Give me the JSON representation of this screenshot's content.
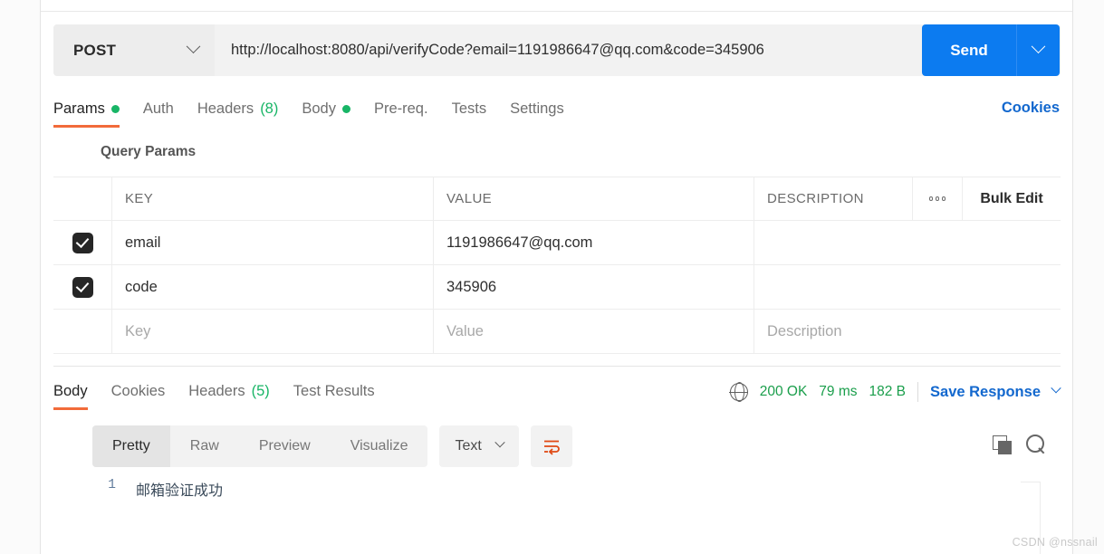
{
  "request": {
    "method": "POST",
    "method_dropdown_icon": "chevron-down-icon",
    "url": "http://localhost:8080/api/verifyCode?email=1191986647@qq.com&code=345906",
    "send_label": "Send",
    "send_dropdown_icon": "chevron-down-icon",
    "cookies_label": "Cookies",
    "tabs": [
      {
        "label": "Params",
        "badge": "",
        "dot": true,
        "active": true
      },
      {
        "label": "Auth",
        "badge": "",
        "dot": false,
        "active": false
      },
      {
        "label": "Headers",
        "badge": "(8)",
        "dot": false,
        "active": false
      },
      {
        "label": "Body",
        "badge": "",
        "dot": true,
        "active": false
      },
      {
        "label": "Pre-req.",
        "badge": "",
        "dot": false,
        "active": false
      },
      {
        "label": "Tests",
        "badge": "",
        "dot": false,
        "active": false
      },
      {
        "label": "Settings",
        "badge": "",
        "dot": false,
        "active": false
      }
    ]
  },
  "query_params": {
    "section_title": "Query Params",
    "columns": [
      "KEY",
      "VALUE",
      "DESCRIPTION"
    ],
    "options_icon": "three-dots-icon",
    "bulk_edit_label": "Bulk Edit",
    "rows": [
      {
        "checked": true,
        "key": "email",
        "value": "1191986647@qq.com",
        "description": ""
      },
      {
        "checked": true,
        "key": "code",
        "value": "345906",
        "description": ""
      }
    ],
    "placeholder_row": {
      "key": "Key",
      "value": "Value",
      "description": "Description"
    }
  },
  "response": {
    "tabs": [
      {
        "label": "Body",
        "badge": "",
        "active": true
      },
      {
        "label": "Cookies",
        "badge": "",
        "active": false
      },
      {
        "label": "Headers",
        "badge": "(5)",
        "active": false
      },
      {
        "label": "Test Results",
        "badge": "",
        "active": false
      }
    ],
    "network_icon": "globe-icon",
    "status": "200 OK",
    "time": "79 ms",
    "size": "182 B",
    "save_response_label": "Save Response",
    "save_response_icon": "chevron-down-icon",
    "viewer": {
      "modes": [
        {
          "label": "Pretty",
          "active": true
        },
        {
          "label": "Raw",
          "active": false
        },
        {
          "label": "Preview",
          "active": false
        },
        {
          "label": "Visualize",
          "active": false
        }
      ],
      "format": "Text",
      "format_icon": "chevron-down-icon",
      "wrap_icon": "word-wrap-icon",
      "copy_icon": "copy-icon",
      "search_icon": "search-icon"
    },
    "body_lines": [
      {
        "number": "1",
        "text": "邮箱验证成功"
      }
    ]
  },
  "watermark": "CSDN @nssnail",
  "colors": {
    "accent_orange": "#f26b3a",
    "brand_blue": "#0c7bf0",
    "link_blue": "#1368ce",
    "status_green": "#1a9e4b",
    "dot_green": "#18b566"
  }
}
